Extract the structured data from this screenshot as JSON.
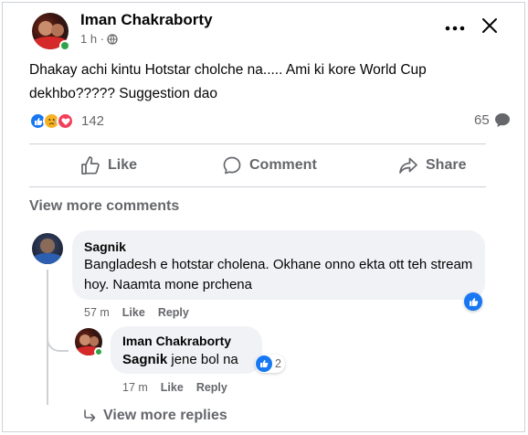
{
  "post": {
    "author": "Iman Chakraborty",
    "time": "1 h ·",
    "text": "Dhakay achi kintu Hotstar cholche na..... Ami ki kore World Cup dekhbo????? Suggestion dao",
    "reaction_icons": [
      "like-icon",
      "sad-icon",
      "love-icon"
    ],
    "reaction_count": "142",
    "comment_count": "65"
  },
  "actions": {
    "like": "Like",
    "comment": "Comment",
    "share": "Share"
  },
  "view_more_comments": "View more comments",
  "comments": [
    {
      "author": "Sagnik",
      "text": "Bangladesh e hotstar cholena. Okhane onno ekta ott teh stream hoy. Naamta mone prchena",
      "time": "57 m",
      "like": "Like",
      "reply": "Reply"
    }
  ],
  "reply": {
    "author": "Iman Chakraborty",
    "mention": "Sagnik",
    "text": " jene bol na",
    "time": "17 m",
    "like": "Like",
    "reply": "Reply",
    "like_count": "2"
  },
  "view_more_replies": "View more replies",
  "colors": {
    "accent": "#1877f2",
    "muted": "#65676b",
    "bubble": "#f0f2f5",
    "online": "#31a24c"
  }
}
